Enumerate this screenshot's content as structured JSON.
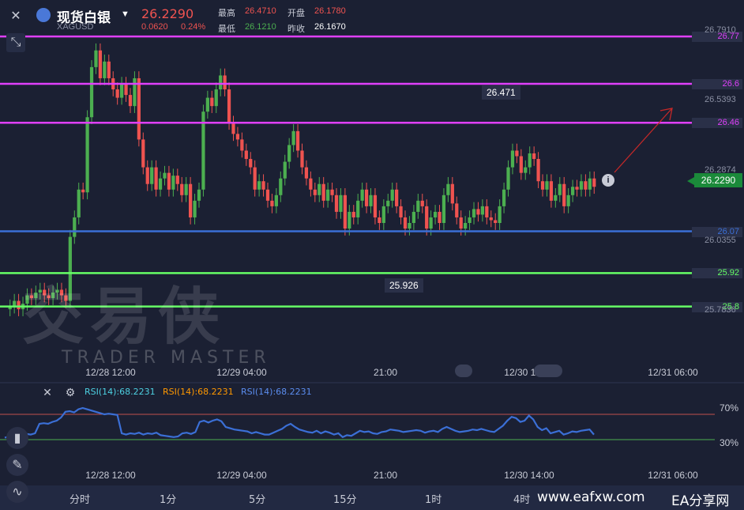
{
  "header": {
    "title": "现货白银",
    "price": "26.2290",
    "symbol": "XAGUSD",
    "change": "0.0620",
    "change_pct": "0.24%",
    "high_label": "最高",
    "high_value": "26.4710",
    "open_label": "开盘",
    "open_value": "26.1780",
    "low_label": "最低",
    "low_value": "26.1210",
    "prev_close_label": "昨收",
    "prev_close_value": "26.1670"
  },
  "watermark": {
    "cn": "交易侠",
    "en": "TRADER MASTER"
  },
  "footer_watermark": {
    "site": "www.eafxw.com",
    "brand": "EA分享网"
  },
  "colors": {
    "up": "#4caf50",
    "down": "#ef5350",
    "magenta": "#e040fb",
    "blue": "#3b6fd6",
    "green": "#66ff66",
    "current": "#1b8a3a"
  },
  "chart_data": [
    {
      "type": "candlestick",
      "title": "现货白银",
      "ylim": [
        25.6,
        26.85
      ],
      "y_axis_ticks": [
        "26.7910",
        "26.5393",
        "26.2874",
        "26.0355",
        "25.7836"
      ],
      "current_price": "26.2290",
      "x_tick_labels": [
        "12/28 12:00",
        "12/29 04:00",
        "21:00",
        "12/30 14:00",
        "12/31 06:00"
      ],
      "horizontal_levels": [
        {
          "value": 26.77,
          "label": "26.77",
          "color": "magenta"
        },
        {
          "value": 26.6,
          "label": "26.6",
          "color": "magenta"
        },
        {
          "value": 26.46,
          "label": "26.46",
          "color": "magenta"
        },
        {
          "value": 26.07,
          "label": "26.07",
          "color": "blue"
        },
        {
          "value": 25.92,
          "label": "25.92",
          "color": "green"
        },
        {
          "value": 25.8,
          "label": "25.8",
          "color": "green"
        }
      ],
      "annotations": [
        {
          "label": "26.471",
          "value": 26.471
        },
        {
          "label": "25.926",
          "value": 25.926
        }
      ],
      "closes": [
        25.8,
        25.82,
        25.79,
        25.81,
        25.84,
        25.83,
        25.85,
        25.86,
        25.84,
        25.83,
        25.85,
        25.86,
        25.84,
        25.82,
        26.05,
        26.12,
        26.22,
        26.21,
        26.48,
        26.66,
        26.72,
        26.62,
        26.68,
        26.62,
        26.58,
        26.55,
        26.6,
        26.56,
        26.52,
        26.62,
        26.4,
        26.3,
        26.24,
        26.3,
        26.22,
        26.26,
        26.28,
        26.22,
        26.27,
        26.24,
        26.2,
        26.24,
        26.12,
        26.18,
        26.22,
        26.5,
        26.55,
        26.52,
        26.58,
        26.63,
        26.58,
        26.46,
        26.42,
        26.4,
        26.36,
        26.33,
        26.3,
        26.22,
        26.25,
        26.22,
        26.18,
        26.16,
        26.2,
        26.26,
        26.32,
        26.38,
        26.43,
        26.36,
        26.3,
        26.26,
        26.22,
        26.2,
        26.24,
        26.18,
        26.22,
        26.2,
        26.14,
        26.2,
        26.08,
        26.14,
        26.12,
        26.18,
        26.22,
        26.16,
        26.2,
        26.12,
        26.1,
        26.16,
        26.18,
        26.22,
        26.16,
        26.12,
        26.08,
        26.1,
        26.14,
        26.18,
        26.16,
        26.08,
        26.12,
        26.14,
        26.1,
        26.2,
        26.24,
        26.17,
        26.12,
        26.08,
        26.1,
        26.12,
        26.15,
        26.13,
        26.16,
        26.12,
        26.11,
        26.1,
        26.16,
        26.22,
        26.3,
        26.36,
        26.34,
        26.28,
        26.3,
        26.35,
        26.33,
        26.25,
        26.22,
        26.25,
        26.18,
        26.2,
        26.24,
        26.16,
        26.2,
        26.23,
        26.22,
        26.25,
        26.22,
        26.26,
        26.23
      ]
    },
    {
      "type": "line",
      "series": [
        {
          "name": "RSI(14)",
          "value_label": "68.2231"
        }
      ],
      "legend": [
        "RSI(14):68.2231",
        "RSI(14):68.2231",
        "RSI(14):68.2231"
      ],
      "ylim": [
        0,
        100
      ],
      "ref_lines": [
        {
          "value": 70,
          "label": "70%"
        },
        {
          "value": 30,
          "label": "30%"
        }
      ],
      "x_tick_labels": [
        "12/28 12:00",
        "12/29 04:00",
        "21:00",
        "12/30 14:00",
        "12/31 06:00"
      ],
      "values": [
        33,
        35,
        37,
        38,
        36,
        39,
        38,
        40,
        55,
        56,
        55,
        58,
        60,
        65,
        74,
        75,
        73,
        78,
        80,
        78,
        76,
        74,
        72,
        70,
        71,
        70,
        69,
        40,
        38,
        40,
        39,
        41,
        38,
        40,
        39,
        41,
        37,
        36,
        35,
        34,
        35,
        40,
        41,
        39,
        42,
        58,
        60,
        57,
        60,
        62,
        59,
        50,
        48,
        46,
        45,
        44,
        43,
        40,
        42,
        40,
        38,
        38,
        41,
        44,
        47,
        52,
        55,
        50,
        46,
        44,
        42,
        41,
        44,
        40,
        43,
        41,
        38,
        40,
        34,
        37,
        36,
        40,
        44,
        42,
        43,
        40,
        39,
        42,
        43,
        46,
        45,
        44,
        42,
        43,
        44,
        45,
        44,
        41,
        43,
        44,
        42,
        47,
        50,
        47,
        44,
        42,
        43,
        44,
        46,
        45,
        47,
        45,
        43,
        42,
        47,
        52,
        60,
        66,
        64,
        58,
        60,
        68,
        62,
        50,
        45,
        48,
        40,
        42,
        44,
        38,
        40,
        43,
        42,
        44,
        45,
        46,
        38
      ]
    }
  ],
  "timeframes": [
    "分时",
    "1分",
    "5分",
    "15分",
    "1时",
    "4时"
  ]
}
